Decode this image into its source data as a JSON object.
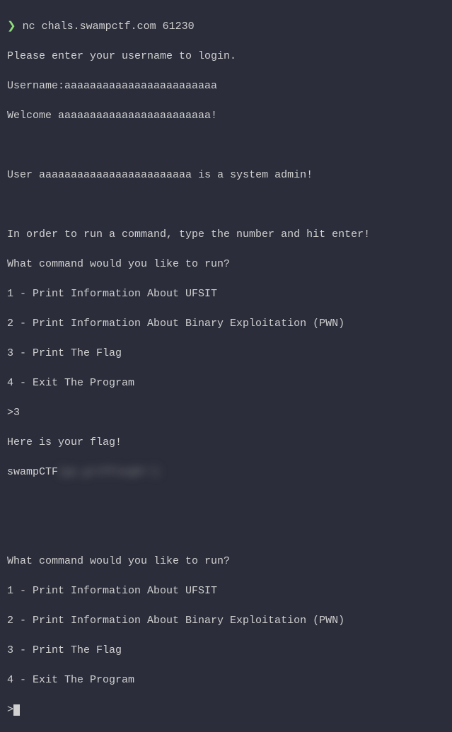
{
  "prompt_symbol": "❯",
  "command": "nc chals.swampctf.com 61230",
  "login_prompt": "Please enter your username to login.",
  "username_label": "Username:",
  "username_input": "aaaaaaaaaaaaaaaaaaaaaaaa",
  "welcome_prefix": "Welcome ",
  "welcome_user": "aaaaaaaaaaaaaaaaaaaaaaaa!",
  "admin_line_prefix": "User ",
  "admin_user": "aaaaaaaaaaaaaaaaaaaaaaaa",
  "admin_line_suffix": " is a system admin!",
  "instruction": "In order to run a command, type the number and hit enter!",
  "menu_prompt": "What command would you like to run?",
  "menu_options": [
    "1 - Print Information About UFSIT",
    "2 - Print Information About Binary Exploitation (PWN)",
    "3 - Print The Flag",
    "4 - Exit The Program"
  ],
  "input_marker": ">",
  "user_choice": "3",
  "flag_header": "Here is your flag!",
  "flag_prefix": "swampCTF",
  "flag_blurred": "{go_gr1fF1ng0r!}"
}
